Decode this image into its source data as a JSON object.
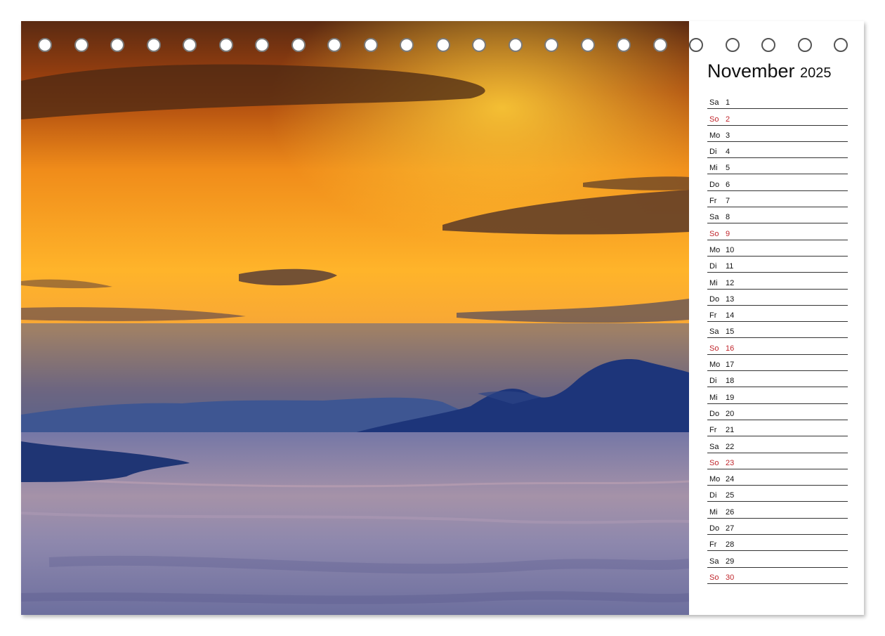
{
  "calendar": {
    "month": "November",
    "year": "2025",
    "days": [
      {
        "name": "Sa",
        "num": "1"
      },
      {
        "name": "So",
        "num": "2",
        "sunday": true
      },
      {
        "name": "Mo",
        "num": "3"
      },
      {
        "name": "Di",
        "num": "4"
      },
      {
        "name": "Mi",
        "num": "5"
      },
      {
        "name": "Do",
        "num": "6"
      },
      {
        "name": "Fr",
        "num": "7"
      },
      {
        "name": "Sa",
        "num": "8"
      },
      {
        "name": "So",
        "num": "9",
        "sunday": true
      },
      {
        "name": "Mo",
        "num": "10"
      },
      {
        "name": "Di",
        "num": "11"
      },
      {
        "name": "Mi",
        "num": "12"
      },
      {
        "name": "Do",
        "num": "13"
      },
      {
        "name": "Fr",
        "num": "14"
      },
      {
        "name": "Sa",
        "num": "15"
      },
      {
        "name": "So",
        "num": "16",
        "sunday": true
      },
      {
        "name": "Mo",
        "num": "17"
      },
      {
        "name": "Di",
        "num": "18"
      },
      {
        "name": "Mi",
        "num": "19"
      },
      {
        "name": "Do",
        "num": "20"
      },
      {
        "name": "Fr",
        "num": "21"
      },
      {
        "name": "Sa",
        "num": "22"
      },
      {
        "name": "So",
        "num": "23",
        "sunday": true
      },
      {
        "name": "Mo",
        "num": "24"
      },
      {
        "name": "Di",
        "num": "25"
      },
      {
        "name": "Mi",
        "num": "26"
      },
      {
        "name": "Do",
        "num": "27"
      },
      {
        "name": "Fr",
        "num": "28"
      },
      {
        "name": "Sa",
        "num": "29"
      },
      {
        "name": "So",
        "num": "30",
        "sunday": true
      }
    ]
  },
  "colors": {
    "sunday": "#c0262c",
    "text": "#111111",
    "sky_orange": "#f39a1c",
    "sky_gold": "#ffc02a",
    "mountains": "#1f3a7a",
    "sea": "#8a86ad"
  }
}
